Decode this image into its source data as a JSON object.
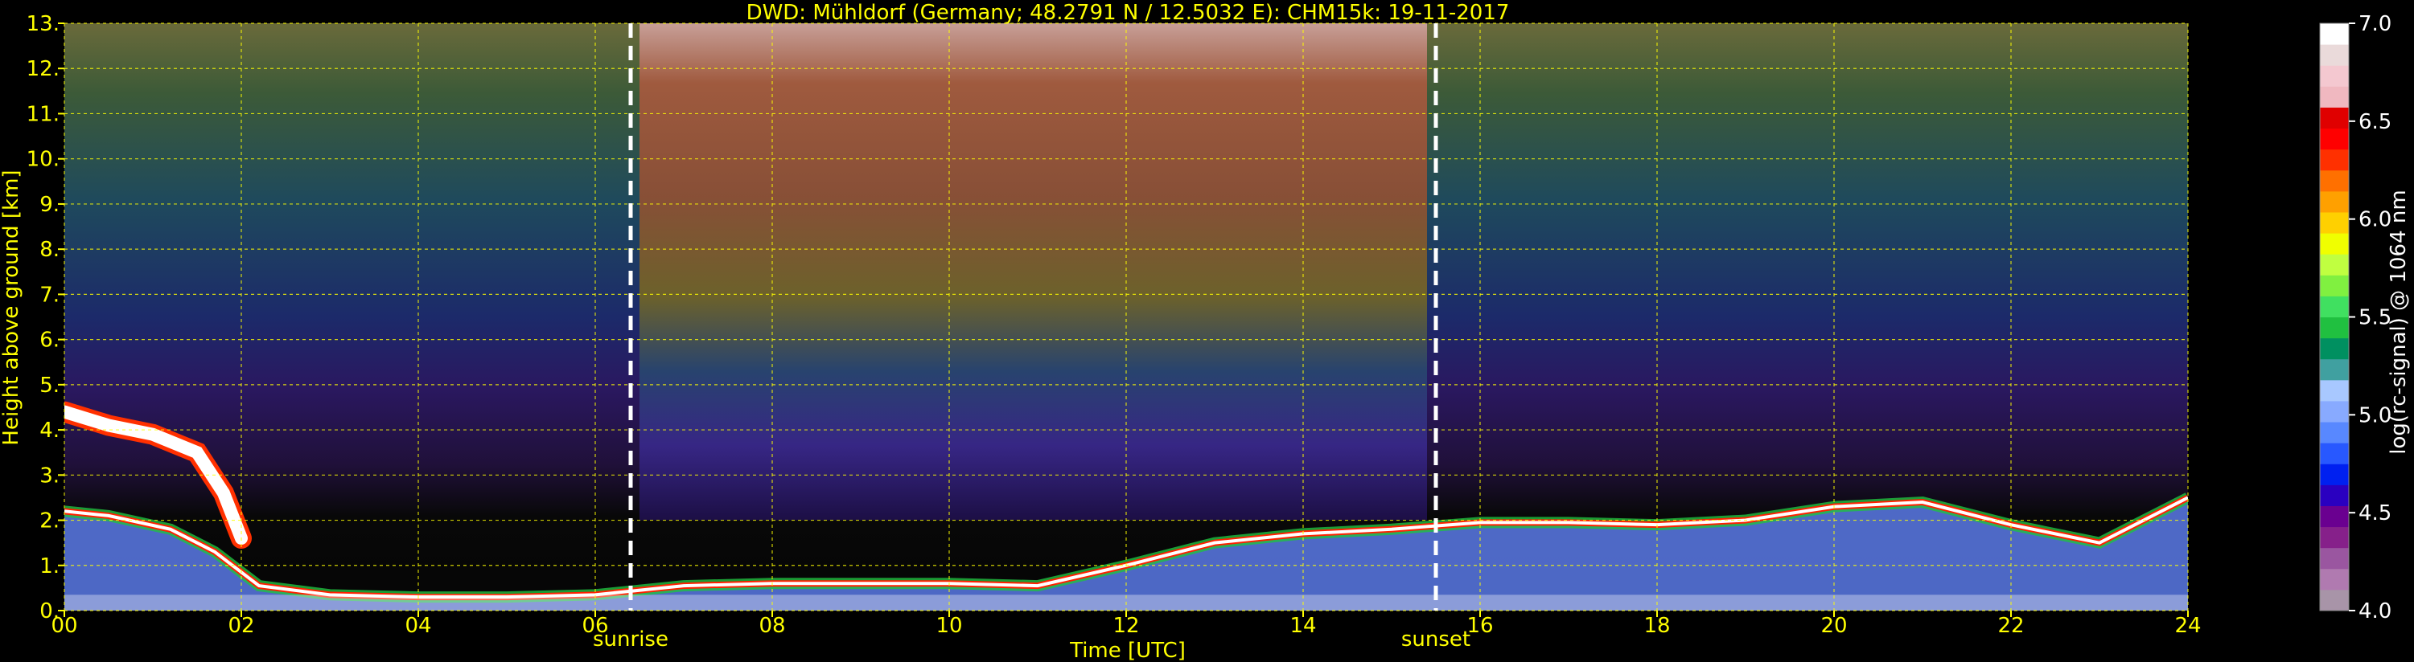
{
  "chart_data": {
    "type": "heatmap",
    "title": "DWD: Mühldorf (Germany; 48.2791 N / 12.5032 E):    CHM15k: 19-11-2017",
    "xlabel": "Time [UTC]",
    "ylabel": "Height above ground [km]",
    "xlim": [
      0,
      24
    ],
    "ylim": [
      0,
      13
    ],
    "x_ticks": [
      "00",
      "02",
      "04",
      "06",
      "08",
      "10",
      "12",
      "14",
      "16",
      "18",
      "20",
      "22",
      "24"
    ],
    "y_ticks": [
      "0.",
      "1.",
      "2.",
      "3.",
      "4.",
      "5.",
      "6.",
      "7.",
      "8.",
      "9.",
      "10.",
      "11.",
      "12.",
      "13."
    ],
    "grid": true,
    "annotations": [
      {
        "label": "sunrise",
        "x": 6.4
      },
      {
        "label": "sunset",
        "x": 15.5
      }
    ],
    "colorbar": {
      "label": "log(rc-signal) @ 1064 nm",
      "range": [
        4.0,
        7.0
      ],
      "ticks": [
        "4.0",
        "4.5",
        "5.0",
        "5.5",
        "6.0",
        "6.5",
        "7.0"
      ],
      "colors": [
        "#a894a8",
        "#b07ab0",
        "#9a56a0",
        "#86208a",
        "#6a0090",
        "#2a00c0",
        "#0020f0",
        "#2858ff",
        "#5888ff",
        "#88aaff",
        "#a8c8ff",
        "#40a0a0",
        "#009060",
        "#20c040",
        "#40e060",
        "#80f040",
        "#c0ff40",
        "#f0ff00",
        "#ffd000",
        "#ffa000",
        "#ff7000",
        "#ff3000",
        "#ff0000",
        "#e00000",
        "#f0b8c0",
        "#f4c8d0",
        "#eadada",
        "#ffffff"
      ]
    },
    "cloud_base_height_km": [
      {
        "x": 0.0,
        "y": 2.2
      },
      {
        "x": 0.5,
        "y": 2.1
      },
      {
        "x": 1.2,
        "y": 1.8
      },
      {
        "x": 1.7,
        "y": 1.3
      },
      {
        "x": 2.2,
        "y": 0.55
      },
      {
        "x": 3.0,
        "y": 0.35
      },
      {
        "x": 4.0,
        "y": 0.3
      },
      {
        "x": 5.0,
        "y": 0.3
      },
      {
        "x": 6.0,
        "y": 0.35
      },
      {
        "x": 7.0,
        "y": 0.55
      },
      {
        "x": 8.0,
        "y": 0.6
      },
      {
        "x": 9.0,
        "y": 0.6
      },
      {
        "x": 10.0,
        "y": 0.6
      },
      {
        "x": 11.0,
        "y": 0.55
      },
      {
        "x": 12.0,
        "y": 1.0
      },
      {
        "x": 13.0,
        "y": 1.5
      },
      {
        "x": 14.0,
        "y": 1.7
      },
      {
        "x": 15.0,
        "y": 1.8
      },
      {
        "x": 16.0,
        "y": 1.95
      },
      {
        "x": 17.0,
        "y": 1.95
      },
      {
        "x": 18.0,
        "y": 1.9
      },
      {
        "x": 19.0,
        "y": 2.0
      },
      {
        "x": 20.0,
        "y": 2.3
      },
      {
        "x": 21.0,
        "y": 2.4
      },
      {
        "x": 22.0,
        "y": 1.9
      },
      {
        "x": 23.0,
        "y": 1.5
      },
      {
        "x": 24.0,
        "y": 2.5
      }
    ],
    "elevated_layer_height_km": [
      {
        "x": 0.0,
        "y": 4.4
      },
      {
        "x": 0.5,
        "y": 4.1
      },
      {
        "x": 1.0,
        "y": 3.9
      },
      {
        "x": 1.5,
        "y": 3.5
      },
      {
        "x": 1.8,
        "y": 2.6
      },
      {
        "x": 2.0,
        "y": 1.6
      }
    ]
  }
}
